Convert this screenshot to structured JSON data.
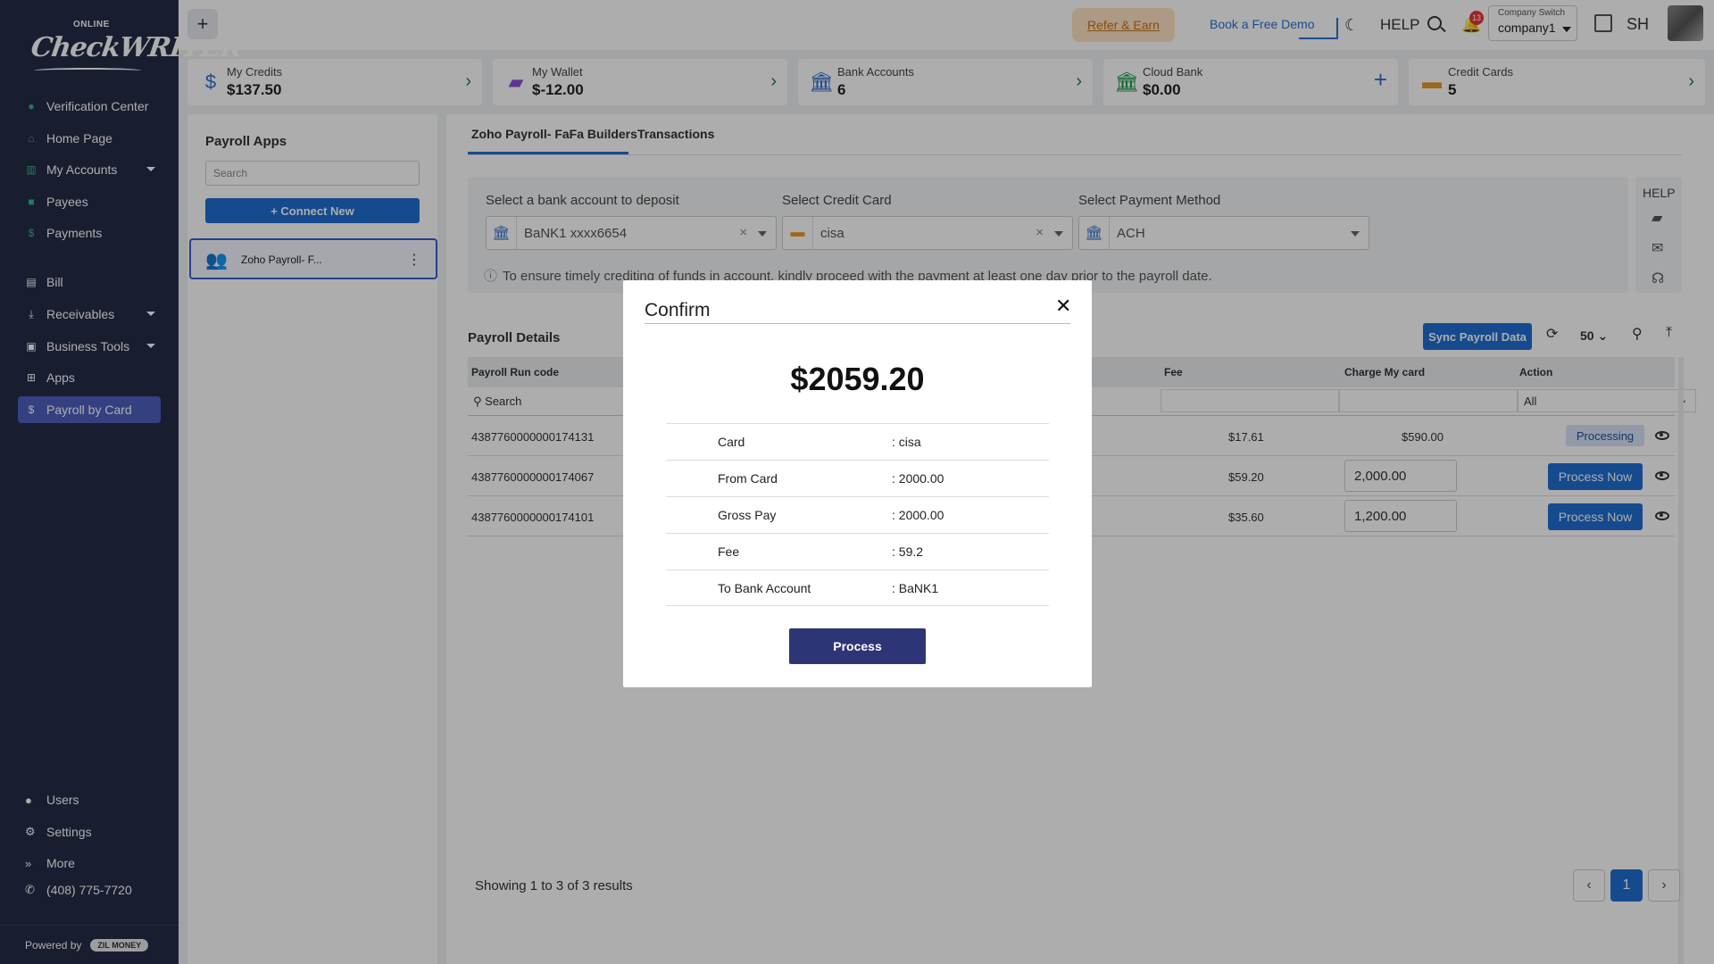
{
  "sidebar": {
    "logo_top": "ONLINE",
    "logo_brand": "CheckWRITER",
    "items": [
      {
        "label": "Verification Center"
      },
      {
        "label": "Home Page"
      },
      {
        "label": "My Accounts"
      },
      {
        "label": "Payees"
      },
      {
        "label": "Payments"
      },
      {
        "label": "Bill"
      },
      {
        "label": "Receivables"
      },
      {
        "label": "Business Tools"
      },
      {
        "label": "Apps"
      },
      {
        "label": "Payroll by Card"
      }
    ],
    "footer": [
      {
        "label": "Users"
      },
      {
        "label": "Settings"
      },
      {
        "label": "More"
      },
      {
        "label": "(408) 775-7720"
      }
    ],
    "powered_by": "Powered by",
    "powered_brand": "ZIL MONEY"
  },
  "topbar": {
    "refer": "Refer & Earn",
    "demo": "Book a Free Demo",
    "help": "HELP",
    "notification_count": "13",
    "company_switch_label": "Company Switch",
    "company_value": "company1",
    "user_initials": "SH"
  },
  "summary_cards": [
    {
      "label": "My Credits",
      "value": "$137.50"
    },
    {
      "label": "My Wallet",
      "value": "$-12.00"
    },
    {
      "label": "Bank Accounts",
      "value": "6"
    },
    {
      "label": "Cloud Bank",
      "value": "$0.00"
    },
    {
      "label": "Credit Cards",
      "value": "5"
    }
  ],
  "payroll_apps": {
    "title": "Payroll Apps",
    "search_placeholder": "Search",
    "connect_label": "+ Connect New",
    "item_name": "Zoho Payroll- F..."
  },
  "main": {
    "tabs": [
      "Zoho Payroll- FaFa Builders",
      "Transactions"
    ],
    "bank_label": "Select a bank account to deposit",
    "bank_value": "BaNK1 xxxx6654",
    "card_label": "Select Credit Card",
    "card_value": "cisa",
    "method_label": "Select Payment Method",
    "method_value": "ACH",
    "info_text": "To ensure timely crediting of funds in account, kindly proceed with the payment at least one day prior to the payroll date.",
    "help_label": "HELP",
    "details_title": "Payroll Details",
    "sync_label": "Sync Payroll Data",
    "page_size": "50",
    "columns": {
      "run_code": "Payroll Run code",
      "fee": "Fee",
      "charge": "Charge My card",
      "action": "Action"
    },
    "filter_search": "Search",
    "filter_all": "All",
    "rows": [
      {
        "code": "4387760000000174131",
        "fee": "$17.61",
        "charge": "$590.00",
        "action": "Processing"
      },
      {
        "code": "4387760000000174067",
        "fee": "$59.20",
        "charge": "2,000.00",
        "action": "Process Now"
      },
      {
        "code": "4387760000000174101",
        "fee": "$35.60",
        "charge": "1,200.00",
        "action": "Process Now"
      }
    ],
    "showing": "Showing 1 to 3 of 3 results",
    "current_page": "1"
  },
  "modal": {
    "title": "Confirm",
    "amount": "$2059.20",
    "rows": [
      {
        "k": "Card",
        "v": ": cisa"
      },
      {
        "k": "From Card",
        "v": ": 2000.00"
      },
      {
        "k": "Gross Pay",
        "v": ": 2000.00"
      },
      {
        "k": "Fee",
        "v": ": 59.2"
      },
      {
        "k": "To Bank Account",
        "v": ": BaNK1"
      }
    ],
    "button": "Process"
  },
  "colors": {
    "sidebar_bg": "#252b47",
    "primary": "#1f6fd1",
    "modal_button": "#2d3577",
    "active_nav": "#4f5fbf"
  }
}
